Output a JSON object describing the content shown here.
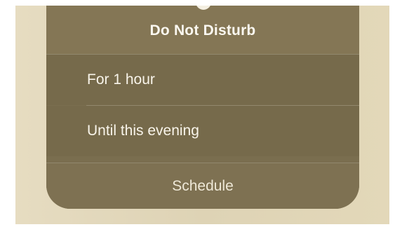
{
  "focus_menu": {
    "title": "Do Not Disturb",
    "options": [
      {
        "label": "For 1 hour"
      },
      {
        "label": "Until this evening"
      }
    ],
    "schedule_label": "Schedule"
  },
  "colors": {
    "panel": "#766a4b",
    "header": "#847655",
    "wallpaper": "#e2d7bb",
    "text": "#f8f4ea"
  }
}
